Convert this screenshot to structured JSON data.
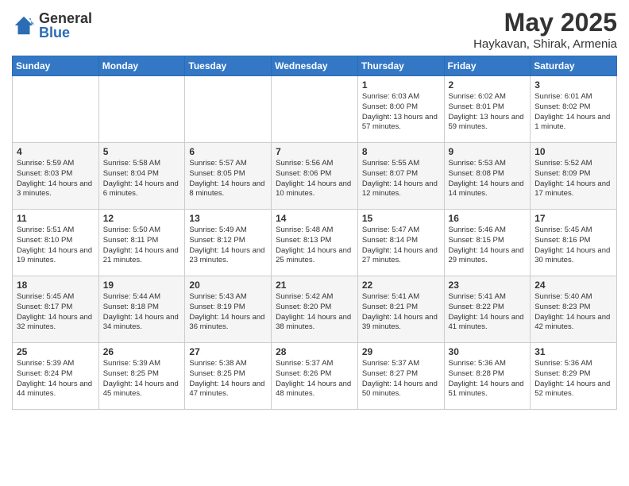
{
  "header": {
    "logo_general": "General",
    "logo_blue": "Blue",
    "title": "May 2025",
    "subtitle": "Haykavan, Shirak, Armenia"
  },
  "calendar": {
    "days_of_week": [
      "Sunday",
      "Monday",
      "Tuesday",
      "Wednesday",
      "Thursday",
      "Friday",
      "Saturday"
    ],
    "weeks": [
      [
        {
          "day": "",
          "info": ""
        },
        {
          "day": "",
          "info": ""
        },
        {
          "day": "",
          "info": ""
        },
        {
          "day": "",
          "info": ""
        },
        {
          "day": "1",
          "info": "Sunrise: 6:03 AM\nSunset: 8:00 PM\nDaylight: 13 hours\nand 57 minutes."
        },
        {
          "day": "2",
          "info": "Sunrise: 6:02 AM\nSunset: 8:01 PM\nDaylight: 13 hours\nand 59 minutes."
        },
        {
          "day": "3",
          "info": "Sunrise: 6:01 AM\nSunset: 8:02 PM\nDaylight: 14 hours\nand 1 minute."
        }
      ],
      [
        {
          "day": "4",
          "info": "Sunrise: 5:59 AM\nSunset: 8:03 PM\nDaylight: 14 hours\nand 3 minutes."
        },
        {
          "day": "5",
          "info": "Sunrise: 5:58 AM\nSunset: 8:04 PM\nDaylight: 14 hours\nand 6 minutes."
        },
        {
          "day": "6",
          "info": "Sunrise: 5:57 AM\nSunset: 8:05 PM\nDaylight: 14 hours\nand 8 minutes."
        },
        {
          "day": "7",
          "info": "Sunrise: 5:56 AM\nSunset: 8:06 PM\nDaylight: 14 hours\nand 10 minutes."
        },
        {
          "day": "8",
          "info": "Sunrise: 5:55 AM\nSunset: 8:07 PM\nDaylight: 14 hours\nand 12 minutes."
        },
        {
          "day": "9",
          "info": "Sunrise: 5:53 AM\nSunset: 8:08 PM\nDaylight: 14 hours\nand 14 minutes."
        },
        {
          "day": "10",
          "info": "Sunrise: 5:52 AM\nSunset: 8:09 PM\nDaylight: 14 hours\nand 17 minutes."
        }
      ],
      [
        {
          "day": "11",
          "info": "Sunrise: 5:51 AM\nSunset: 8:10 PM\nDaylight: 14 hours\nand 19 minutes."
        },
        {
          "day": "12",
          "info": "Sunrise: 5:50 AM\nSunset: 8:11 PM\nDaylight: 14 hours\nand 21 minutes."
        },
        {
          "day": "13",
          "info": "Sunrise: 5:49 AM\nSunset: 8:12 PM\nDaylight: 14 hours\nand 23 minutes."
        },
        {
          "day": "14",
          "info": "Sunrise: 5:48 AM\nSunset: 8:13 PM\nDaylight: 14 hours\nand 25 minutes."
        },
        {
          "day": "15",
          "info": "Sunrise: 5:47 AM\nSunset: 8:14 PM\nDaylight: 14 hours\nand 27 minutes."
        },
        {
          "day": "16",
          "info": "Sunrise: 5:46 AM\nSunset: 8:15 PM\nDaylight: 14 hours\nand 29 minutes."
        },
        {
          "day": "17",
          "info": "Sunrise: 5:45 AM\nSunset: 8:16 PM\nDaylight: 14 hours\nand 30 minutes."
        }
      ],
      [
        {
          "day": "18",
          "info": "Sunrise: 5:45 AM\nSunset: 8:17 PM\nDaylight: 14 hours\nand 32 minutes."
        },
        {
          "day": "19",
          "info": "Sunrise: 5:44 AM\nSunset: 8:18 PM\nDaylight: 14 hours\nand 34 minutes."
        },
        {
          "day": "20",
          "info": "Sunrise: 5:43 AM\nSunset: 8:19 PM\nDaylight: 14 hours\nand 36 minutes."
        },
        {
          "day": "21",
          "info": "Sunrise: 5:42 AM\nSunset: 8:20 PM\nDaylight: 14 hours\nand 38 minutes."
        },
        {
          "day": "22",
          "info": "Sunrise: 5:41 AM\nSunset: 8:21 PM\nDaylight: 14 hours\nand 39 minutes."
        },
        {
          "day": "23",
          "info": "Sunrise: 5:41 AM\nSunset: 8:22 PM\nDaylight: 14 hours\nand 41 minutes."
        },
        {
          "day": "24",
          "info": "Sunrise: 5:40 AM\nSunset: 8:23 PM\nDaylight: 14 hours\nand 42 minutes."
        }
      ],
      [
        {
          "day": "25",
          "info": "Sunrise: 5:39 AM\nSunset: 8:24 PM\nDaylight: 14 hours\nand 44 minutes."
        },
        {
          "day": "26",
          "info": "Sunrise: 5:39 AM\nSunset: 8:25 PM\nDaylight: 14 hours\nand 45 minutes."
        },
        {
          "day": "27",
          "info": "Sunrise: 5:38 AM\nSunset: 8:25 PM\nDaylight: 14 hours\nand 47 minutes."
        },
        {
          "day": "28",
          "info": "Sunrise: 5:37 AM\nSunset: 8:26 PM\nDaylight: 14 hours\nand 48 minutes."
        },
        {
          "day": "29",
          "info": "Sunrise: 5:37 AM\nSunset: 8:27 PM\nDaylight: 14 hours\nand 50 minutes."
        },
        {
          "day": "30",
          "info": "Sunrise: 5:36 AM\nSunset: 8:28 PM\nDaylight: 14 hours\nand 51 minutes."
        },
        {
          "day": "31",
          "info": "Sunrise: 5:36 AM\nSunset: 8:29 PM\nDaylight: 14 hours\nand 52 minutes."
        }
      ]
    ]
  }
}
